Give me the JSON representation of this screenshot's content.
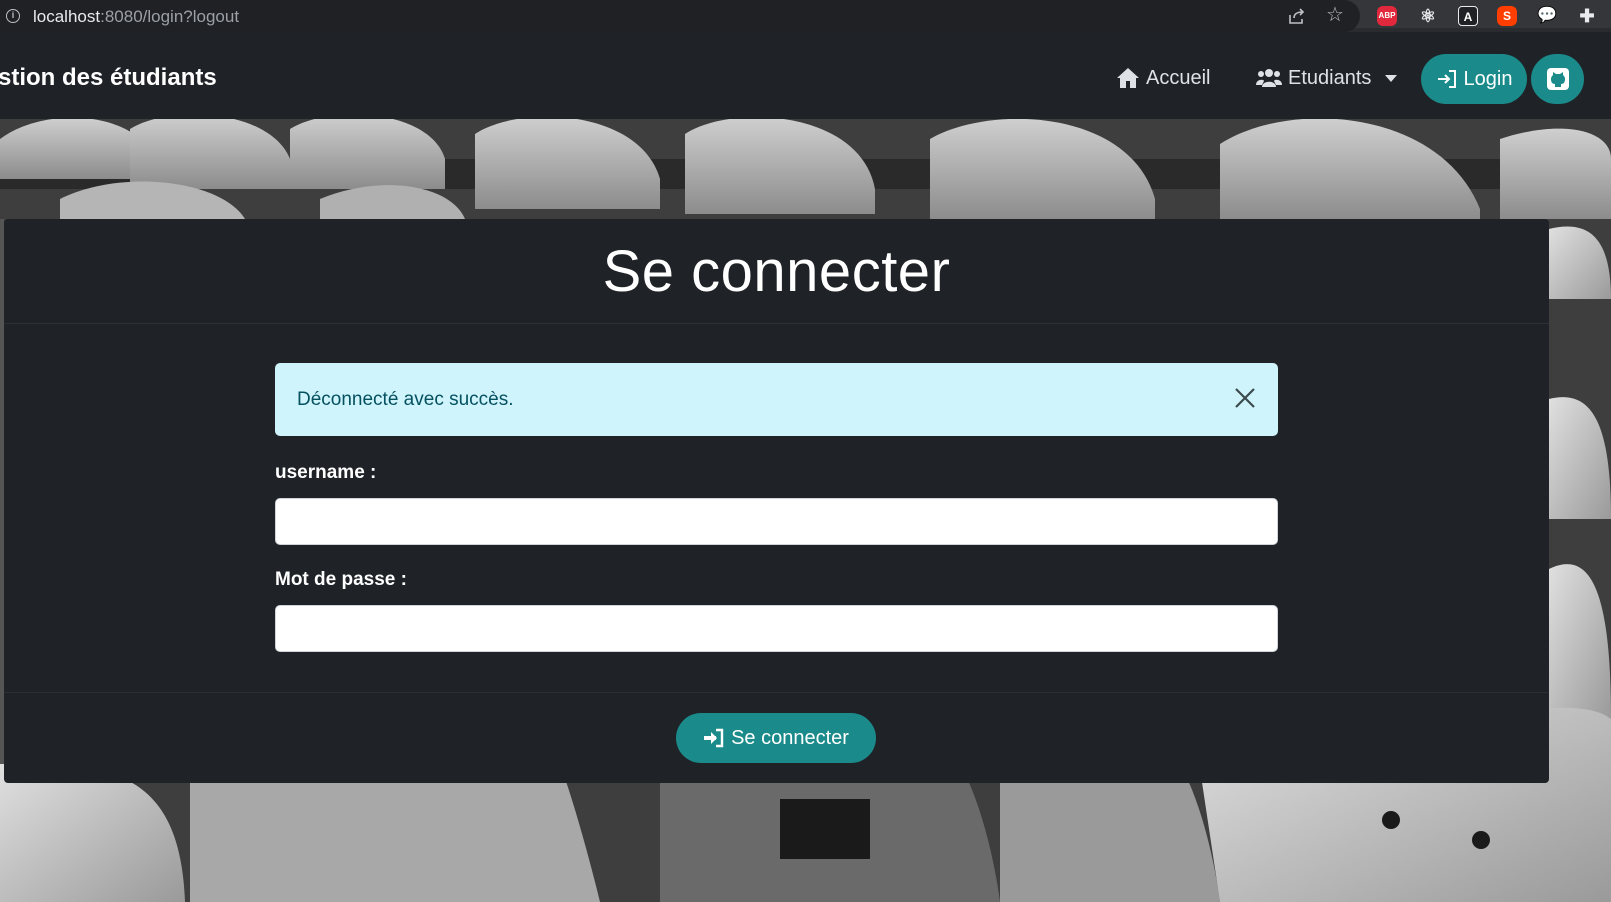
{
  "browser": {
    "url_host": "localhost",
    "url_rest": ":8080/login?logout",
    "extensions": {
      "abp": "ABP",
      "angular": "A",
      "svelte": "S"
    }
  },
  "navbar": {
    "brand": "stion des étudiants",
    "accueil": "Accueil",
    "etudiants": "Etudiants",
    "login": "Login",
    "accent": "#1b8a8a"
  },
  "card": {
    "title": "Se connecter",
    "alert": {
      "text": "Déconnecté avec succès.",
      "bg": "#cff4fc"
    },
    "username_label": "username :",
    "password_label": "Mot de passe :",
    "username_value": "",
    "password_value": "",
    "submit": "Se connecter"
  }
}
